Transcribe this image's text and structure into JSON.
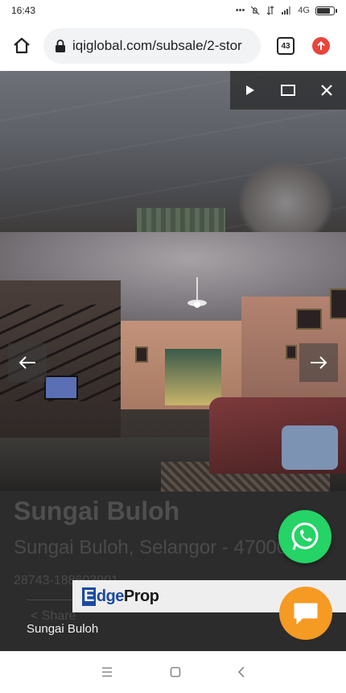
{
  "status_bar": {
    "time": "16:43",
    "icons": [
      "dots-icon",
      "mute-icon",
      "data-icon",
      "signal-icon"
    ],
    "network": "4G",
    "battery_level": 0.85
  },
  "browser": {
    "url": "iqiglobal.com/subsale/2-stor",
    "tab_count": "43",
    "accent": "#e8453c"
  },
  "viewer": {
    "buttons": [
      "play-icon",
      "fullscreen-icon",
      "close-icon"
    ],
    "caption": "Sungai Buloh"
  },
  "listing": {
    "title": "Sungai Buloh",
    "address": "Sungai Buloh, Selangor - 47000",
    "id": "28743-188603901",
    "share_label": "Share"
  },
  "banner": {
    "logo_e": "E",
    "logo_dge": "dge",
    "logo_prop": "Prop"
  },
  "colors": {
    "whatsapp": "#25d366",
    "chat": "#f59a23",
    "edgeprop_blue": "#1b4aa3"
  }
}
